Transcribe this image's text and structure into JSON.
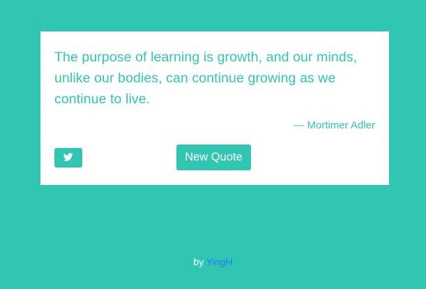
{
  "quote": {
    "text": "The purpose of learning is growth, and our minds, unlike our bodies, can continue growing as we continue to live.",
    "author": "— Mortimer Adler"
  },
  "buttons": {
    "tweet_icon": "twitter-icon",
    "new_quote_label": "New Quote"
  },
  "footer": {
    "prefix": "by",
    "author_link": "YingH"
  },
  "colors": {
    "background": "#31c6b2",
    "card": "#ffffff",
    "accent": "#31c6b2",
    "link": "#1f7bff"
  }
}
